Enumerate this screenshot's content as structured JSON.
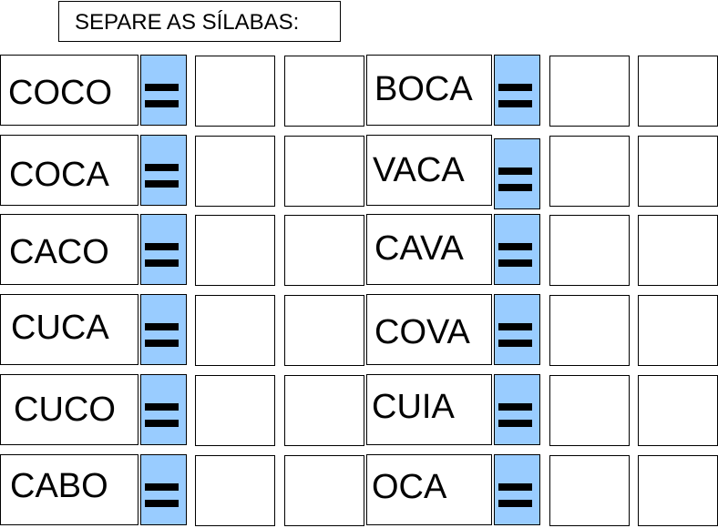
{
  "title": "SEPARE AS SÍLABAS:",
  "equals_color": "#99ccff",
  "left_column": [
    {
      "word": "COCO"
    },
    {
      "word": "COCA"
    },
    {
      "word": "CACO"
    },
    {
      "word": "CUCA"
    },
    {
      "word": "CUCO"
    },
    {
      "word": "CABO"
    }
  ],
  "right_column": [
    {
      "word": "BOCA"
    },
    {
      "word": "VACA"
    },
    {
      "word": "CAVA"
    },
    {
      "word": "COVA"
    },
    {
      "word": "CUIA"
    },
    {
      "word": "OCA"
    }
  ],
  "answer_boxes_per_word": 2,
  "answers": {
    "left": [
      [
        "",
        ""
      ],
      [
        "",
        ""
      ],
      [
        "",
        ""
      ],
      [
        "",
        ""
      ],
      [
        "",
        ""
      ],
      [
        "",
        ""
      ]
    ],
    "right": [
      [
        "",
        ""
      ],
      [
        "",
        ""
      ],
      [
        "",
        ""
      ],
      [
        "",
        ""
      ],
      [
        "",
        ""
      ],
      [
        "",
        ""
      ]
    ]
  }
}
